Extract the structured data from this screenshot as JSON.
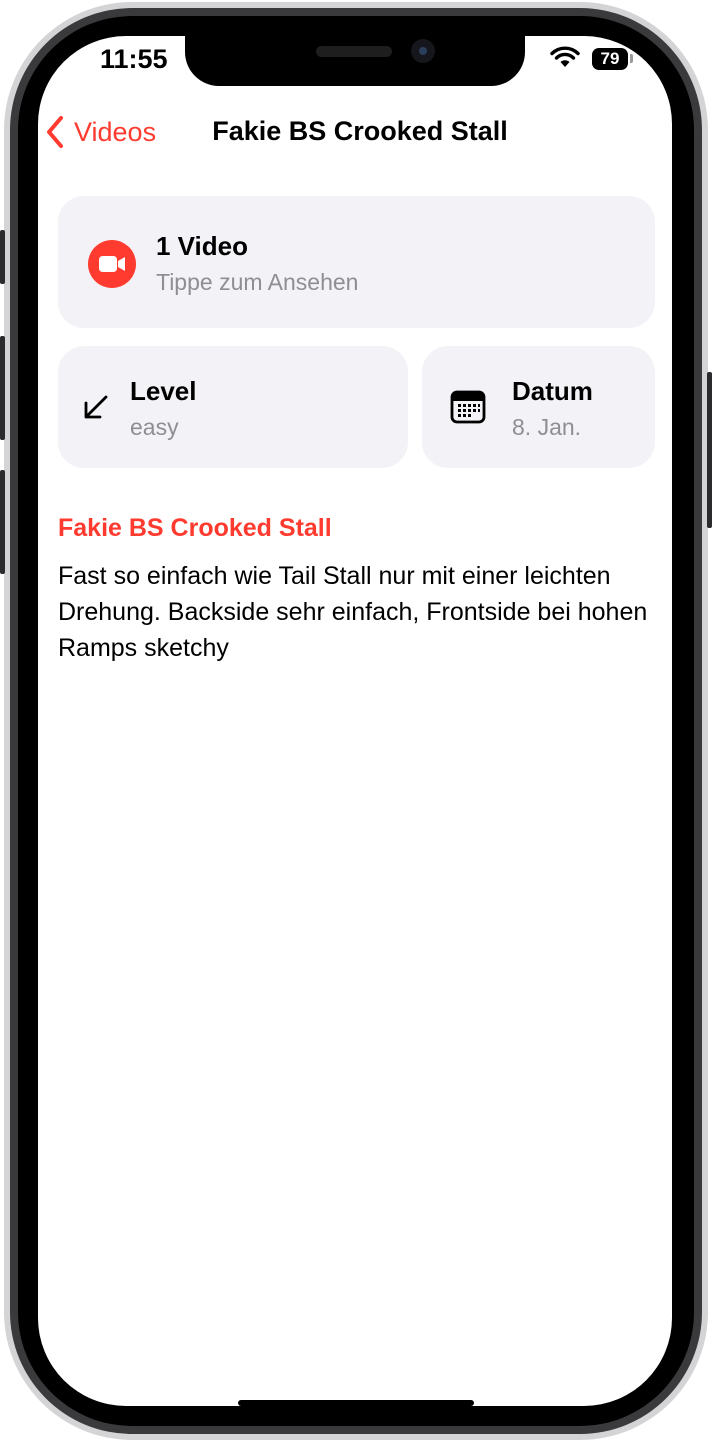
{
  "status_bar": {
    "time": "11:55",
    "battery": "79"
  },
  "nav": {
    "back_label": "Videos",
    "title": "Fakie BS Crooked Stall"
  },
  "video_card": {
    "title": "1 Video",
    "subtitle": "Tippe zum Ansehen"
  },
  "level_card": {
    "title": "Level",
    "value": "easy"
  },
  "date_card": {
    "title": "Datum",
    "value": "8. Jan."
  },
  "detail": {
    "heading": "Fakie BS Crooked Stall",
    "description": "Fast so einfach wie Tail Stall nur mit einer leichten Drehung. Backside sehr einfach, Frontside bei hohen Ramps sketchy"
  },
  "icons": {
    "back": "chevron-left-icon",
    "video": "video-camera-icon",
    "level": "arrow-down-left-icon",
    "date": "calendar-icon",
    "wifi": "wifi-icon",
    "battery": "battery-icon"
  },
  "colors": {
    "accent": "#ff3b30",
    "card_bg": "#f2f2f7",
    "secondary_text": "#8e8e93"
  }
}
